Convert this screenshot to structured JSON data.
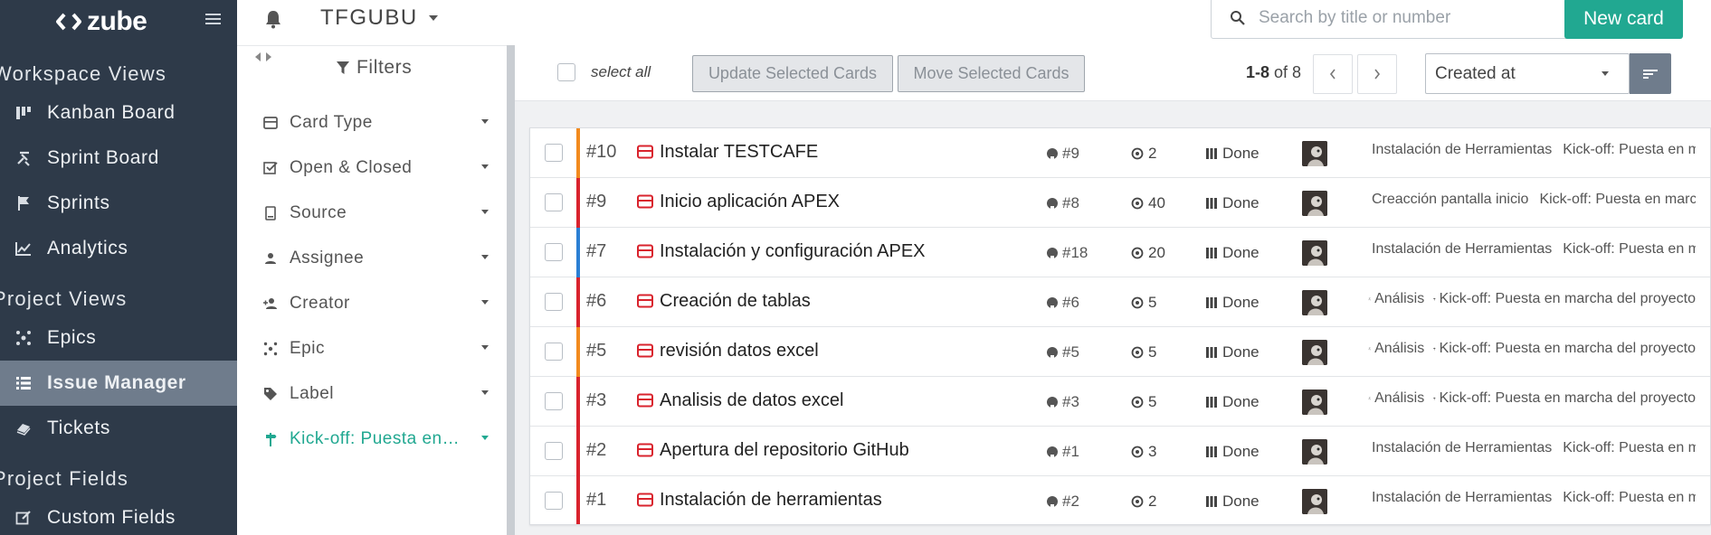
{
  "brand": {
    "name": "zube"
  },
  "sidebar": {
    "sections": [
      {
        "title": "Workspace Views"
      },
      {
        "title": "Project Views"
      },
      {
        "title": "Project Fields"
      }
    ],
    "items": [
      {
        "label": "Kanban Board",
        "icon": "kanban-icon"
      },
      {
        "label": "Sprint Board",
        "icon": "sprint-board-icon"
      },
      {
        "label": "Sprints",
        "icon": "flag-icon"
      },
      {
        "label": "Analytics",
        "icon": "chart-line-icon"
      },
      {
        "label": "Epics",
        "icon": "epics-icon"
      },
      {
        "label": "Issue Manager",
        "icon": "list-icon",
        "active": true
      },
      {
        "label": "Tickets",
        "icon": "tickets-icon"
      },
      {
        "label": "Custom Fields",
        "icon": "edit-icon"
      }
    ]
  },
  "topbar": {
    "project_name": "TFGUBU",
    "search_placeholder": "Search by title or number",
    "new_card_label": "New card"
  },
  "filters": {
    "title": "Filters",
    "items": [
      {
        "label": "Card Type",
        "icon": "card-type-icon"
      },
      {
        "label": "Open & Closed",
        "icon": "checkbox-icon"
      },
      {
        "label": "Source",
        "icon": "source-icon"
      },
      {
        "label": "Assignee",
        "icon": "person-icon"
      },
      {
        "label": "Creator",
        "icon": "person-add-icon"
      },
      {
        "label": "Epic",
        "icon": "epic-icon"
      },
      {
        "label": "Label",
        "icon": "tag-icon"
      },
      {
        "label": "Kick-off: Puesta en marcha del proyecto",
        "icon": "milestone-icon",
        "active": true
      }
    ]
  },
  "toolbar": {
    "select_all": "select all",
    "update_button": "Update Selected Cards",
    "move_button": "Move Selected Cards",
    "page_range": "1-8",
    "page_of": "of 8",
    "sort_value": "Created at"
  },
  "cards": [
    {
      "number": "#10",
      "title": "Instalar TESTCAFE",
      "gh": "#9",
      "points": "2",
      "status": "Done",
      "bar_color": "#f28a1e",
      "tag1": "Instalación de Herramientas",
      "tag2": "Kick-off: Puesta en marcha del proyecto"
    },
    {
      "number": "#9",
      "title": "Inicio aplicación APEX",
      "gh": "#8",
      "points": "40",
      "status": "Done",
      "bar_color": "#d9232d",
      "tag1": "Creacción pantalla inicio",
      "tag2": "Kick-off: Puesta en marcha del proyecto"
    },
    {
      "number": "#7",
      "title": "Instalación y configuración APEX",
      "gh": "#18",
      "points": "20",
      "status": "Done",
      "bar_color": "#2b7fd4",
      "tag1": "Instalación de Herramientas",
      "tag2": "Kick-off: Puesta en marcha del proyecto"
    },
    {
      "number": "#6",
      "title": "Creación de tablas",
      "gh": "#6",
      "points": "5",
      "status": "Done",
      "bar_color": "#d9232d",
      "tag1": "Análisis",
      "tag2": "Kick-off: Puesta en marcha del proyecto"
    },
    {
      "number": "#5",
      "title": "revisión datos excel",
      "gh": "#5",
      "points": "5",
      "status": "Done",
      "bar_color": "#f28a1e",
      "tag1": "Análisis",
      "tag2": "Kick-off: Puesta en marcha del proyecto"
    },
    {
      "number": "#3",
      "title": "Analisis de datos excel",
      "gh": "#3",
      "points": "5",
      "status": "Done",
      "bar_color": "#d9232d",
      "tag1": "Análisis",
      "tag2": "Kick-off: Puesta en marcha del proyecto"
    },
    {
      "number": "#2",
      "title": "Apertura del repositorio GitHub",
      "gh": "#1",
      "points": "3",
      "status": "Done",
      "bar_color": "#d9232d",
      "tag1": "Instalación de Herramientas",
      "tag2": "Kick-off: Puesta en marcha del proyecto"
    },
    {
      "number": "#1",
      "title": "Instalación de herramientas",
      "gh": "#2",
      "points": "2",
      "status": "Done",
      "bar_color": "#d9232d",
      "tag1": "Instalación de Herramientas",
      "tag2": "Kick-off: Puesta en marcha del proyecto"
    }
  ],
  "colors": {
    "sidebar_bg": "#2e3a49",
    "active_nav": "#6f7c8c",
    "accent_teal": "#21a891",
    "card_type_red": "#d9232d"
  }
}
